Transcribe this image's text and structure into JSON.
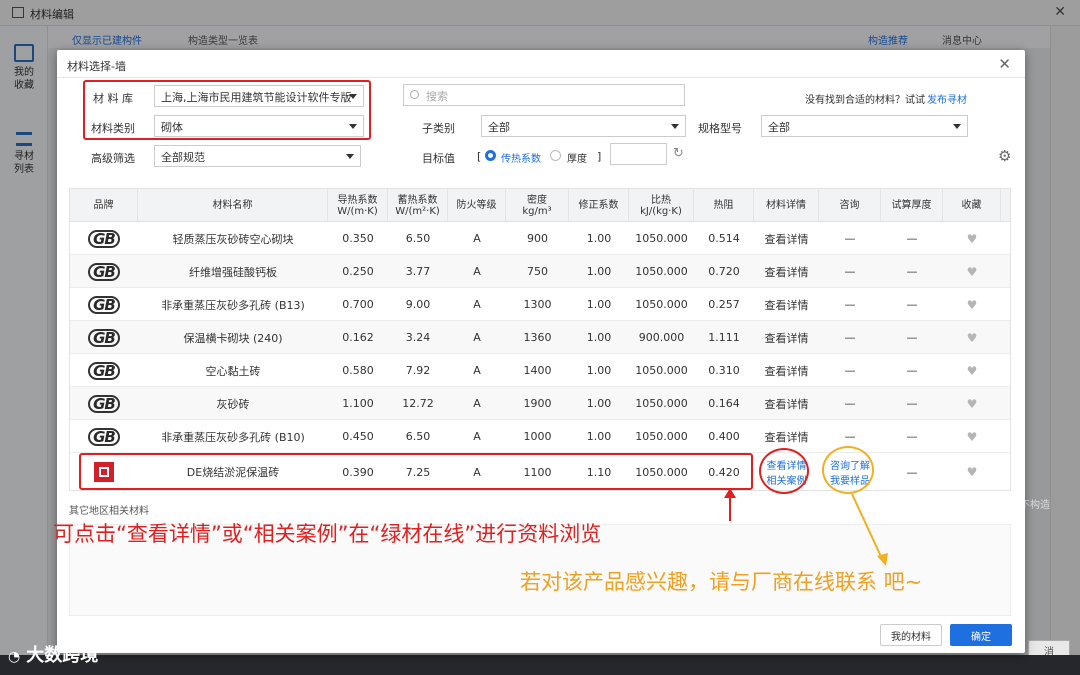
{
  "bg": {
    "title": "材料编辑",
    "left_items": [
      "我的收藏",
      "寻材列表"
    ],
    "toolbar": [
      "仅显示已建构件",
      "构造类型一览表",
      "构造推荐",
      "消息中心"
    ],
    "right_fragment": "不构造",
    "right_btn_fragment": "消"
  },
  "modal": {
    "title": "材料选择-墙",
    "filters": {
      "library_label": "材 料 库",
      "library_value": "上海,上海市民用建筑节能设计软件专版",
      "category_label": "材料类别",
      "category_value": "砌体",
      "advanced_label": "高级筛选",
      "advanced_value": "全部规范",
      "search_placeholder": "搜索",
      "sub_label": "子类别",
      "sub_value": "全部",
      "spec_label": "规格型号",
      "spec_value": "全部",
      "target_label": "目标值",
      "bracket_open": "[",
      "bracket_close": "]",
      "radio_conductivity": "传热系数",
      "radio_thickness": "厚度",
      "not_found_text": "没有找到合适的材料？试试",
      "not_found_link": "发布寻材"
    },
    "columns": [
      "品牌",
      "材料名称",
      "导热系数 W/(m·K)",
      "蓄热系数 W/(m²·K)",
      "防火等级",
      "密度 kg/m³",
      "修正系数",
      "比热 kJ/(kg·K)",
      "热阻",
      "材料详情",
      "咨询",
      "试算厚度",
      "收藏"
    ],
    "rows": [
      {
        "brand": "GB",
        "name": "轻质蒸压灰砂砖空心砌块",
        "k": "0.350",
        "s": "6.50",
        "fire": "A",
        "density": "900",
        "factor": "1.00",
        "heat": "1050.000",
        "r": "0.514",
        "detail": "查看详情",
        "consult": "—",
        "trial": "—"
      },
      {
        "brand": "GB",
        "name": "纤维增强硅酸钙板",
        "k": "0.250",
        "s": "3.77",
        "fire": "A",
        "density": "750",
        "factor": "1.00",
        "heat": "1050.000",
        "r": "0.720",
        "detail": "查看详情",
        "consult": "—",
        "trial": "—"
      },
      {
        "brand": "GB",
        "name": "非承重蒸压灰砂多孔砖 (B13)",
        "k": "0.700",
        "s": "9.00",
        "fire": "A",
        "density": "1300",
        "factor": "1.00",
        "heat": "1050.000",
        "r": "0.257",
        "detail": "查看详情",
        "consult": "—",
        "trial": "—"
      },
      {
        "brand": "GB",
        "name": "保温横卡砌块 (240)",
        "k": "0.162",
        "s": "3.24",
        "fire": "A",
        "density": "1360",
        "factor": "1.00",
        "heat": "900.000",
        "r": "1.111",
        "detail": "查看详情",
        "consult": "—",
        "trial": "—"
      },
      {
        "brand": "GB",
        "name": "空心黏土砖",
        "k": "0.580",
        "s": "7.92",
        "fire": "A",
        "density": "1400",
        "factor": "1.00",
        "heat": "1050.000",
        "r": "0.310",
        "detail": "查看详情",
        "consult": "—",
        "trial": "—"
      },
      {
        "brand": "GB",
        "name": "灰砂砖",
        "k": "1.100",
        "s": "12.72",
        "fire": "A",
        "density": "1900",
        "factor": "1.00",
        "heat": "1050.000",
        "r": "0.164",
        "detail": "查看详情",
        "consult": "—",
        "trial": "—"
      },
      {
        "brand": "GB",
        "name": "非承重蒸压灰砂多孔砖 (B10)",
        "k": "0.450",
        "s": "6.50",
        "fire": "A",
        "density": "1000",
        "factor": "1.00",
        "heat": "1050.000",
        "r": "0.400",
        "detail": "查看详情",
        "consult": "—",
        "trial": "—"
      }
    ],
    "special_row": {
      "name": "DE烧结淤泥保温砖",
      "k": "0.390",
      "s": "7.25",
      "fire": "A",
      "density": "1100",
      "factor": "1.10",
      "heat": "1050.000",
      "r": "0.420",
      "detail1": "查看详情",
      "detail2": "相关案例",
      "consult1": "咨询了解",
      "consult2": "我要样品",
      "trial": "—"
    },
    "section_label": "其它地区相关材料",
    "btn_my": "我的材料",
    "btn_ok": "确定"
  },
  "annotations": {
    "red": "可点击“查看详情”或“相关案例”在“绿材在线”进行资料浏览",
    "orange": "若对该产品感兴趣，请与厂商在线联系 吧~"
  },
  "watermark": "大数跨境",
  "colors": {
    "accent": "#1e6fe0",
    "annotation_red": "#e02020",
    "annotation_orange": "#f0a020"
  }
}
